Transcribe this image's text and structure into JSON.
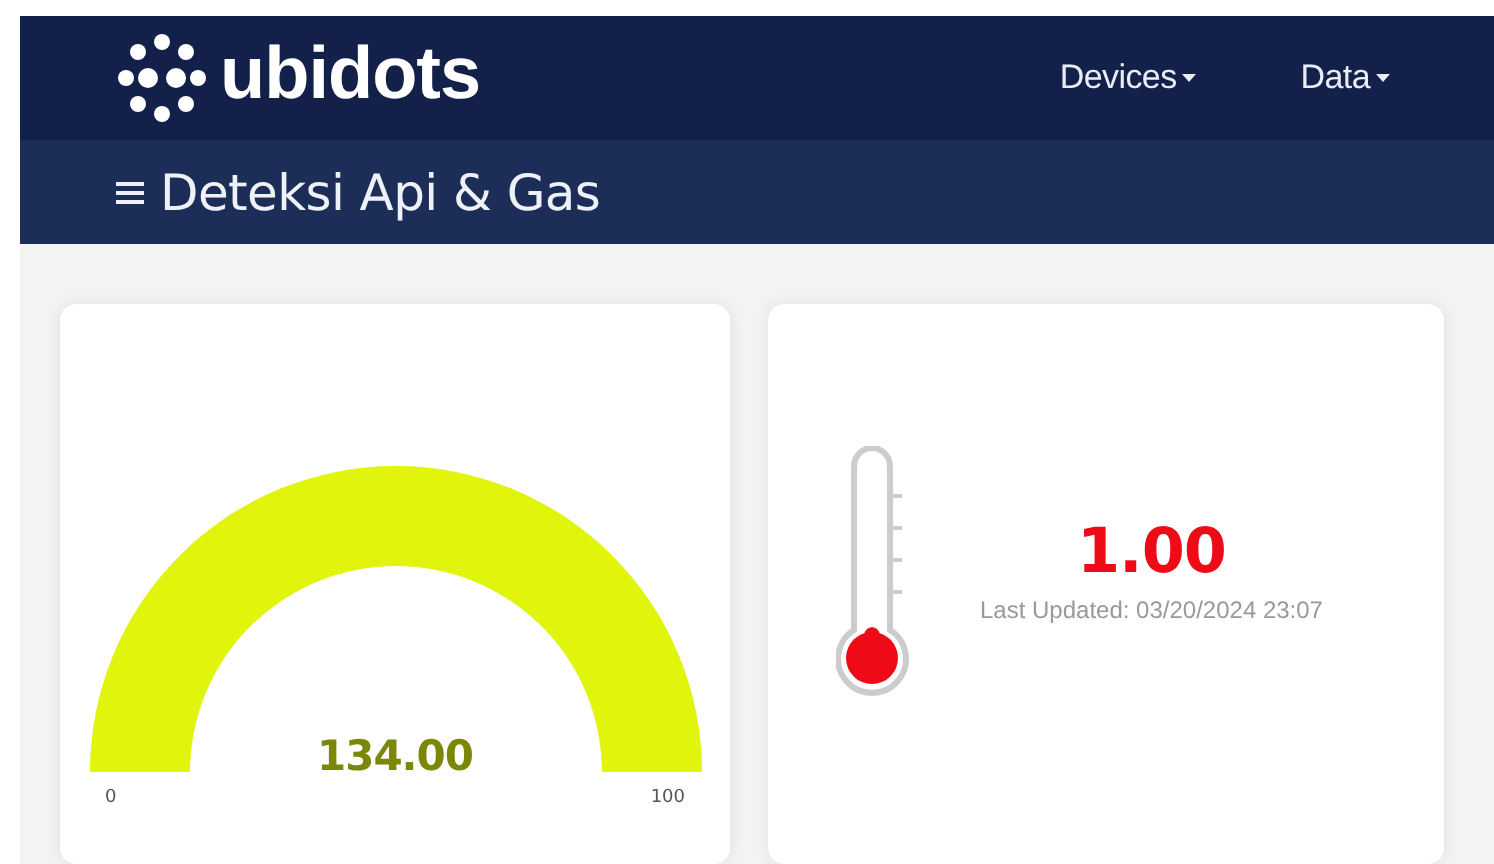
{
  "navbar": {
    "logo": "ubidots",
    "menu": [
      {
        "label": "Devices",
        "has_dropdown": true
      },
      {
        "label": "Data",
        "has_dropdown": true
      }
    ]
  },
  "dashboard": {
    "title": "Deteksi Api & Gas"
  },
  "widgets": [
    {
      "kind": "gauge",
      "value": "134.00",
      "min_label": "0",
      "max_label": "100",
      "color": "#e1f50c"
    },
    {
      "kind": "thermometer",
      "value": "1.00",
      "last_updated": "Last Updated: 03/20/2024 23:07",
      "color": "#ee0a17"
    }
  ]
}
